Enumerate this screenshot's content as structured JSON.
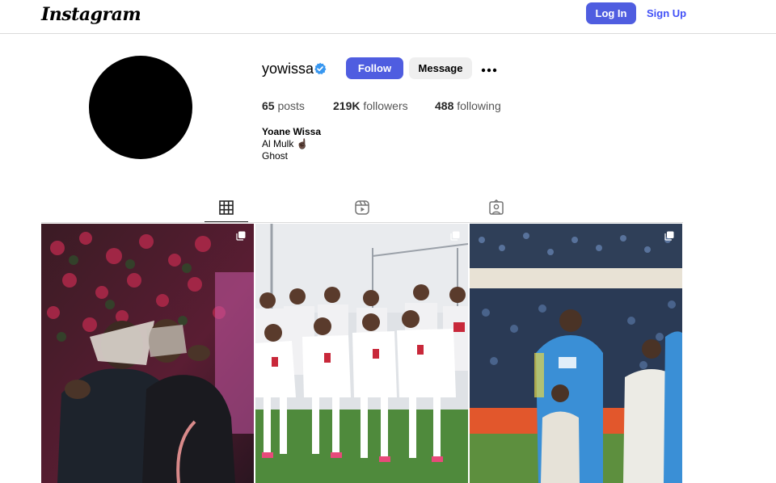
{
  "header": {
    "logo": "Instagram",
    "login_label": "Log In",
    "signup_label": "Sign Up"
  },
  "profile": {
    "username": "yowissa",
    "verified": true,
    "follow_label": "Follow",
    "message_label": "Message",
    "more_icon": "more-options-icon",
    "stats": {
      "posts_count": "65",
      "posts_label": "posts",
      "followers_count": "219K",
      "followers_label": "followers",
      "following_count": "488",
      "following_label": "following"
    },
    "bio": {
      "name": "Yoane Wissa",
      "line1": "Al Mulk ☝🏿",
      "line2": "Ghost"
    }
  },
  "tabs": [
    {
      "icon": "grid-icon",
      "active": true
    },
    {
      "icon": "reels-icon",
      "active": false
    },
    {
      "icon": "tagged-icon",
      "active": false
    }
  ],
  "posts": [
    {
      "type": "carousel",
      "icon": "carousel-icon"
    },
    {
      "type": "carousel",
      "icon": "carousel-icon"
    },
    {
      "type": "carousel",
      "icon": "carousel-icon"
    }
  ],
  "colors": {
    "accent": "#4f5de0",
    "link": "#4150f7",
    "verified": "#3897f0"
  }
}
